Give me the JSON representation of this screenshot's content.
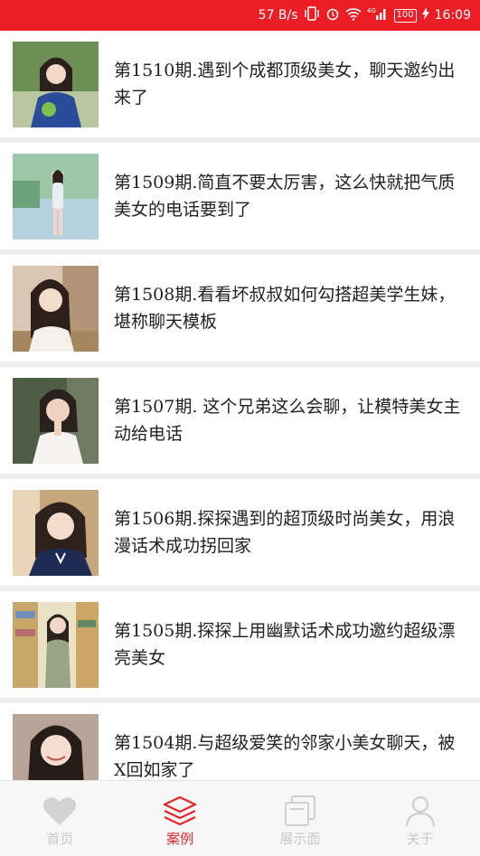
{
  "status_bar": {
    "speed": "57 B/s",
    "network": "4G",
    "battery": "100",
    "time": "16:09"
  },
  "cases": [
    {
      "title": "第1510期.遇到个成都顶级美女，聊天邀约出来了"
    },
    {
      "title": "第1509期.简直不要太厉害，这么快就把气质美女的电话要到了"
    },
    {
      "title": "第1508期.看看坏叔叔如何勾搭超美学生妹，堪称聊天模板"
    },
    {
      "title": "第1507期. 这个兄弟这么会聊，让模特美女主动给电话"
    },
    {
      "title": "第1506期.探探遇到的超顶级时尚美女，用浪漫话术成功拐回家"
    },
    {
      "title": "第1505期.探探上用幽默话术成功邀约超级漂亮美女"
    },
    {
      "title": "第1504期.与超级爱笑的邻家小美女聊天，被X回如家了"
    }
  ],
  "tabs": [
    {
      "label": "首页",
      "icon": "heart-icon",
      "active": false
    },
    {
      "label": "案例",
      "icon": "layers-icon",
      "active": true
    },
    {
      "label": "展示面",
      "icon": "cards-icon",
      "active": false
    },
    {
      "label": "关于",
      "icon": "user-icon",
      "active": false
    }
  ],
  "colors": {
    "accent": "#ec1d24",
    "tab_active": "#e0262c",
    "tab_inactive": "#c8c8c8"
  }
}
